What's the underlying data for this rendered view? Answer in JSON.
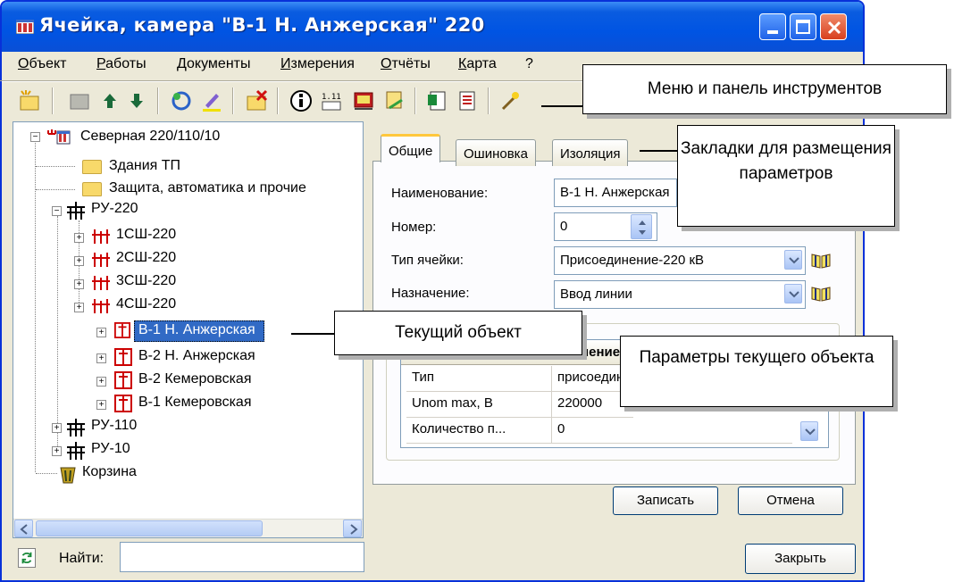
{
  "window": {
    "title": "Ячейка, камера \"В-1 Н. Анжерская\" 220"
  },
  "menu": [
    "Объект",
    "Работы",
    "Документы",
    "Измерения",
    "Отчёты",
    "Карта",
    "?"
  ],
  "toolbar": {
    "icons": [
      "new-cell-icon",
      "folder-icon",
      "arrow-up-icon",
      "arrow-down-icon",
      "refresh-icon",
      "pen-icon",
      "delete-icon",
      "info-icon",
      "measurement-icon",
      "report-icon",
      "export-icon",
      "document-icon",
      "document-list-icon",
      "magic-wand-icon"
    ]
  },
  "tree": {
    "root": "Северная 220/110/10",
    "folders": [
      "Здания ТП",
      "Защита, автоматика и прочие"
    ],
    "ru220": "РУ-220",
    "buses": [
      "1СШ-220",
      "2СШ-220",
      "3СШ-220",
      "4СШ-220"
    ],
    "cells": [
      "В-1 Н. Анжерская",
      "В-2 Н. Анжерская",
      "В-2 Кемеровская",
      "В-1 Кемеровская"
    ],
    "ru110": "РУ-110",
    "ru10": "РУ-10",
    "trash": "Корзина"
  },
  "find": {
    "label": "Найти:",
    "value": ""
  },
  "tabs": [
    "Общие",
    "Ошиновка",
    "Изоляция"
  ],
  "form": {
    "name_label": "Наименование:",
    "name_value": "В-1 Н. Анжерская",
    "number_label": "Номер:",
    "number_value": "0",
    "cell_type_label": "Тип ячейки:",
    "cell_type_value": "Присоединение-220 кВ",
    "purpose_label": "Назначение:",
    "purpose_value": "Ввод линии"
  },
  "grid": {
    "header_right": "Значение",
    "rows": [
      {
        "name": "Тип",
        "value": "присоединение"
      },
      {
        "name": "Unom max, В",
        "value": "220000"
      },
      {
        "name": "Количество п...",
        "value": "0"
      }
    ]
  },
  "buttons": {
    "save": "Записать",
    "cancel": "Отмена",
    "close": "Закрыть"
  },
  "callouts": {
    "menu_toolbar": "Меню и панель инструментов",
    "tabs": "Закладки для размещения параметров",
    "current_object": "Текущий объект",
    "current_params": "Параметры текущего объекта"
  },
  "colors": {
    "titlebar": "#0054e3",
    "selection": "#316ac5",
    "window_bg": "#ece9d8"
  }
}
